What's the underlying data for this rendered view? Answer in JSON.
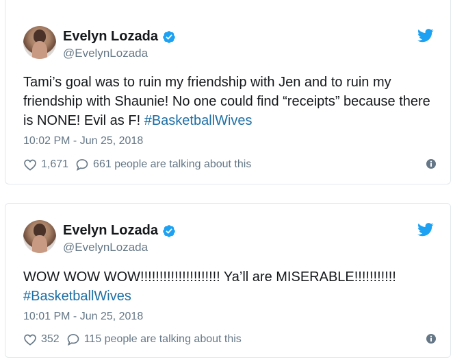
{
  "colors": {
    "brand": "#1da1f2",
    "hashtag": "#1c6ea4",
    "muted": "#657786",
    "text": "#14171a",
    "border": "#e1e8ed"
  },
  "tweets": [
    {
      "display_name": "Evelyn Lozada",
      "handle": "@EvelynLozada",
      "text": "Tami’s goal was to ruin my friendship with Jen and to ruin my friendship with Shaunie! No one could find “receipts” because there is NONE! Evil as F! ",
      "hashtag": "#BasketballWives",
      "timestamp": "10:02 PM - Jun 25, 2018",
      "likes": "1,671",
      "replies_text": "661 people are talking about this",
      "icons": {
        "verified": "verified-badge-icon",
        "logo": "twitter-bird-icon",
        "like": "heart-icon",
        "reply": "speech-bubble-icon",
        "info": "info-icon"
      }
    },
    {
      "display_name": "Evelyn Lozada",
      "handle": "@EvelynLozada",
      "text": "WOW WOW WOW!!!!!!!!!!!!!!!!!!!!! Ya’ll are MISERABLE!!!!!!!!!!!\n",
      "hashtag": "#BasketballWives",
      "timestamp": "10:01 PM - Jun 25, 2018",
      "likes": "352",
      "replies_text": "115 people are talking about this",
      "icons": {
        "verified": "verified-badge-icon",
        "logo": "twitter-bird-icon",
        "like": "heart-icon",
        "reply": "speech-bubble-icon",
        "info": "info-icon"
      }
    }
  ]
}
